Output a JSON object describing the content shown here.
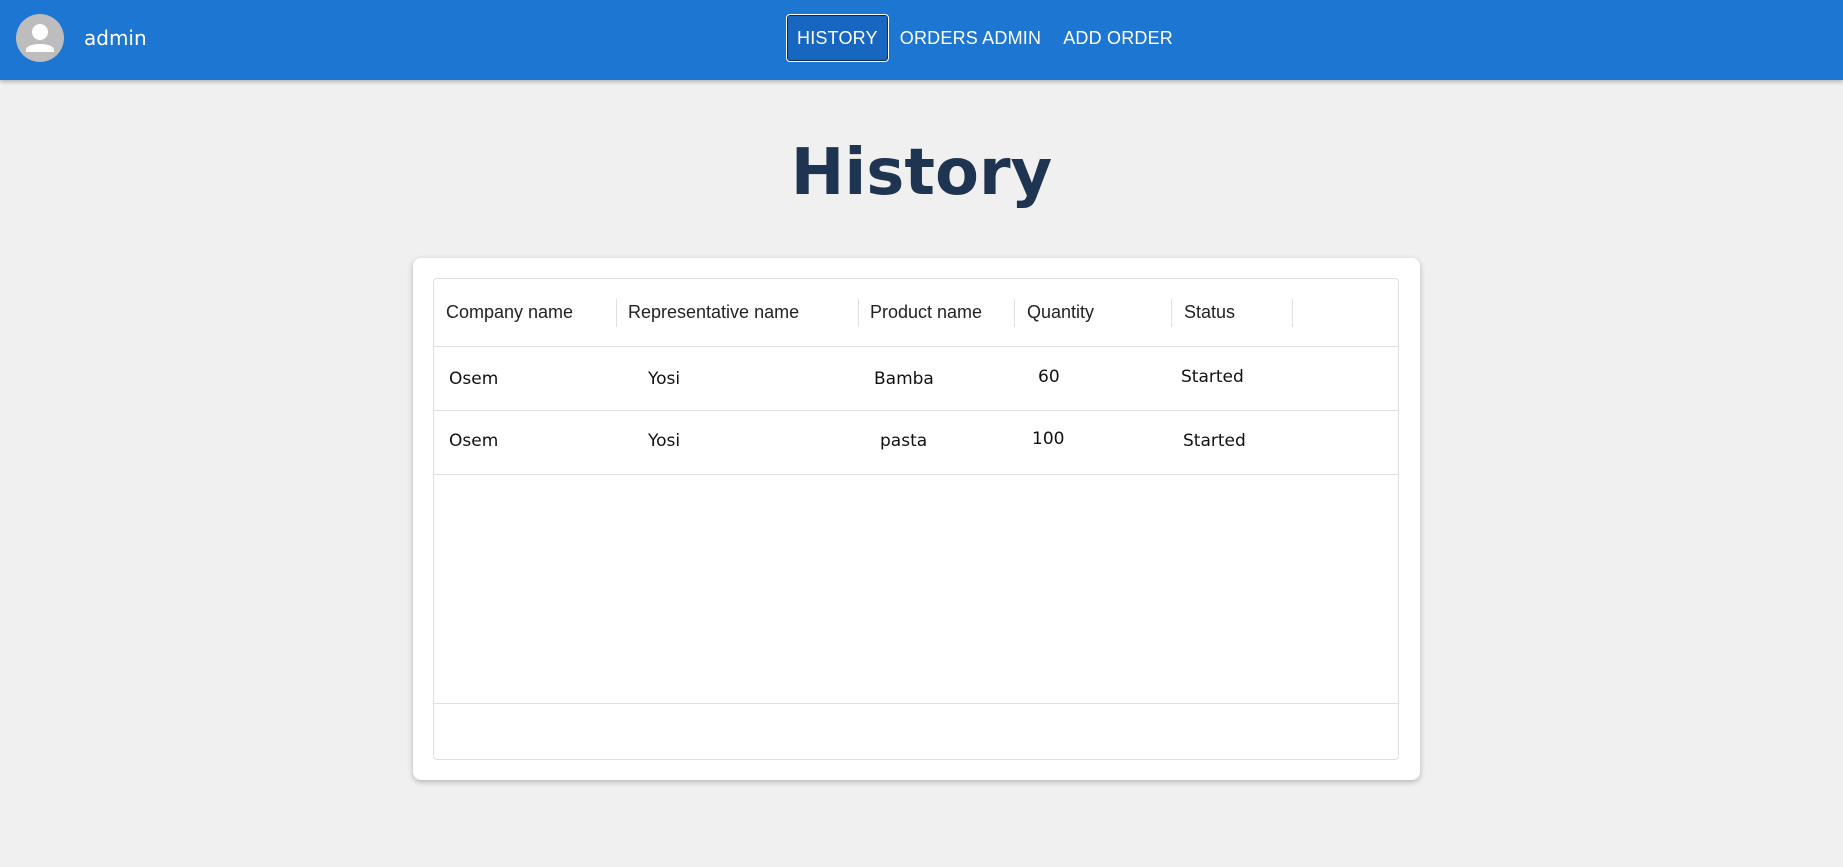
{
  "header": {
    "username": "admin",
    "nav": [
      {
        "label": "HISTORY",
        "active": true
      },
      {
        "label": "ORDERS ADMIN",
        "active": false
      },
      {
        "label": "ADD ORDER",
        "active": false
      }
    ]
  },
  "page": {
    "title": "History"
  },
  "table": {
    "columns": [
      "Company name",
      "Representative name",
      "Product name",
      "Quantity",
      "Status"
    ],
    "rows": [
      {
        "company": "Osem",
        "representative": "Yosi",
        "product": "Bamba",
        "quantity": "60",
        "status": "Started"
      },
      {
        "company": "Osem",
        "representative": "Yosi",
        "product": "pasta",
        "quantity": "100",
        "status": "Started"
      }
    ]
  },
  "colors": {
    "topbar": "#1c76d2",
    "background": "#f0f0f0",
    "title": "#1f3450"
  },
  "icons": {
    "avatar": "person-icon"
  }
}
